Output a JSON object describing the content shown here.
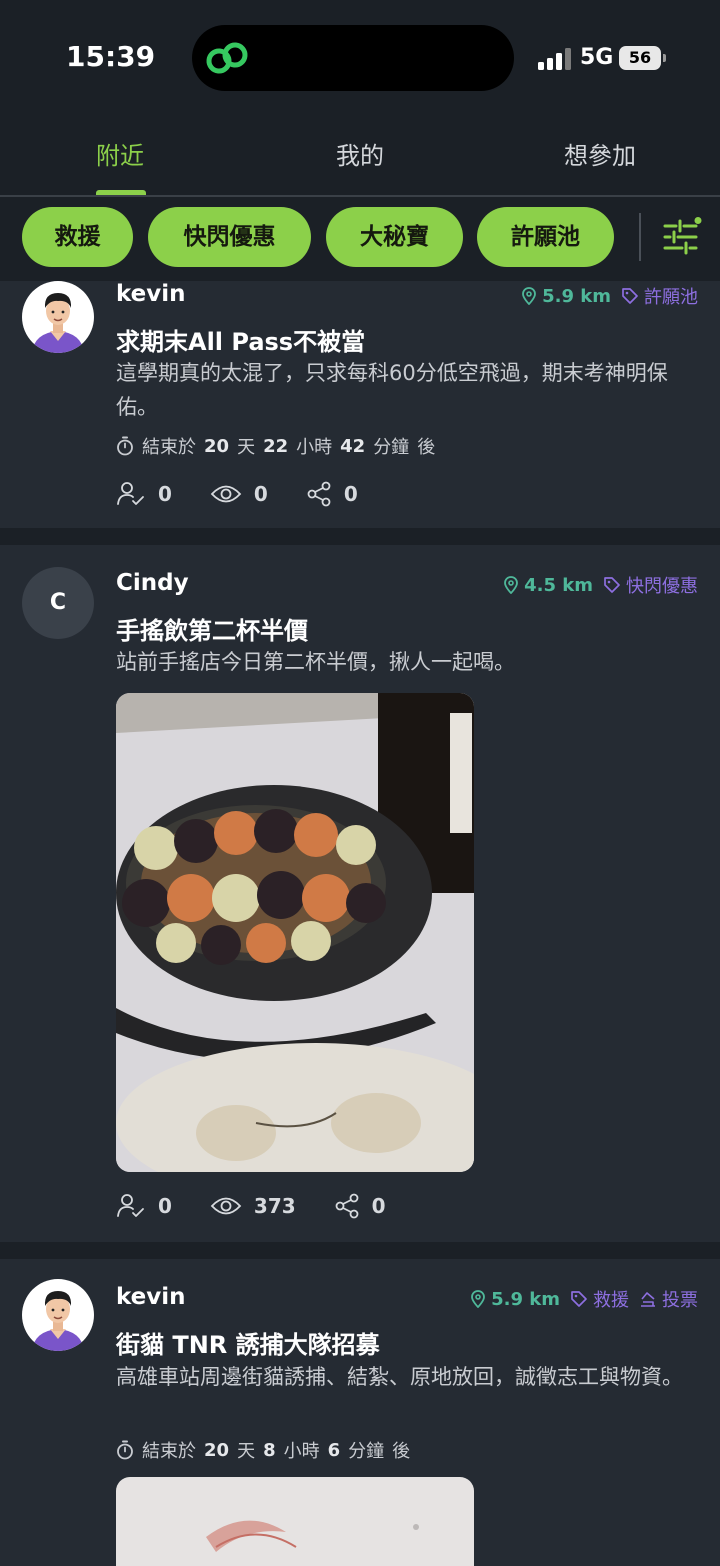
{
  "status_bar": {
    "time": "15:39",
    "network": "5G",
    "battery": "56"
  },
  "tabs": [
    {
      "label": "附近",
      "active": true
    },
    {
      "label": "我的",
      "active": false
    },
    {
      "label": "想參加",
      "active": false
    }
  ],
  "filters": [
    {
      "label": "救援"
    },
    {
      "label": "快閃優惠"
    },
    {
      "label": "大秘寶"
    },
    {
      "label": "許願池"
    }
  ],
  "posts": [
    {
      "user": "kevin",
      "distance": "5.9 km",
      "tags": [
        "許願池"
      ],
      "title": "求期末All Pass不被當",
      "body": "這學期真的太混了，只求每科60分低空飛過，期末考神明保佑。",
      "deadline": {
        "prefix": "結束於",
        "days": "20",
        "days_unit": "天",
        "hours": "22",
        "hours_unit": "小時",
        "minutes": "42",
        "minutes_unit": "分鐘",
        "suffix": "後"
      },
      "stats": {
        "participants": "0",
        "views": "0",
        "shares": "0"
      }
    },
    {
      "user": "Cindy",
      "avatar_letter": "C",
      "distance": "4.5 km",
      "tags": [
        "快閃優惠"
      ],
      "title": "手搖飲第二杯半價",
      "body": "站前手搖店今日第二杯半價，揪人一起喝。",
      "stats": {
        "participants": "0",
        "views": "373",
        "shares": "0"
      }
    },
    {
      "user": "kevin",
      "distance": "5.9 km",
      "tags": [
        "救援"
      ],
      "vote_label": "投票",
      "title": "街貓 TNR 誘捕大隊招募",
      "body": "高雄車站周邊街貓誘捕、結紮、原地放回，誠徵志工與物資。",
      "deadline": {
        "prefix": "結束於",
        "days": "20",
        "days_unit": "天",
        "hours": "8",
        "hours_unit": "小時",
        "minutes": "6",
        "minutes_unit": "分鐘",
        "suffix": "後"
      }
    }
  ],
  "colors": {
    "accent": "#8cd04a",
    "distance": "#4fb89a",
    "tag": "#8d6fe0",
    "card": "#252b33",
    "background": "#1b2026"
  }
}
